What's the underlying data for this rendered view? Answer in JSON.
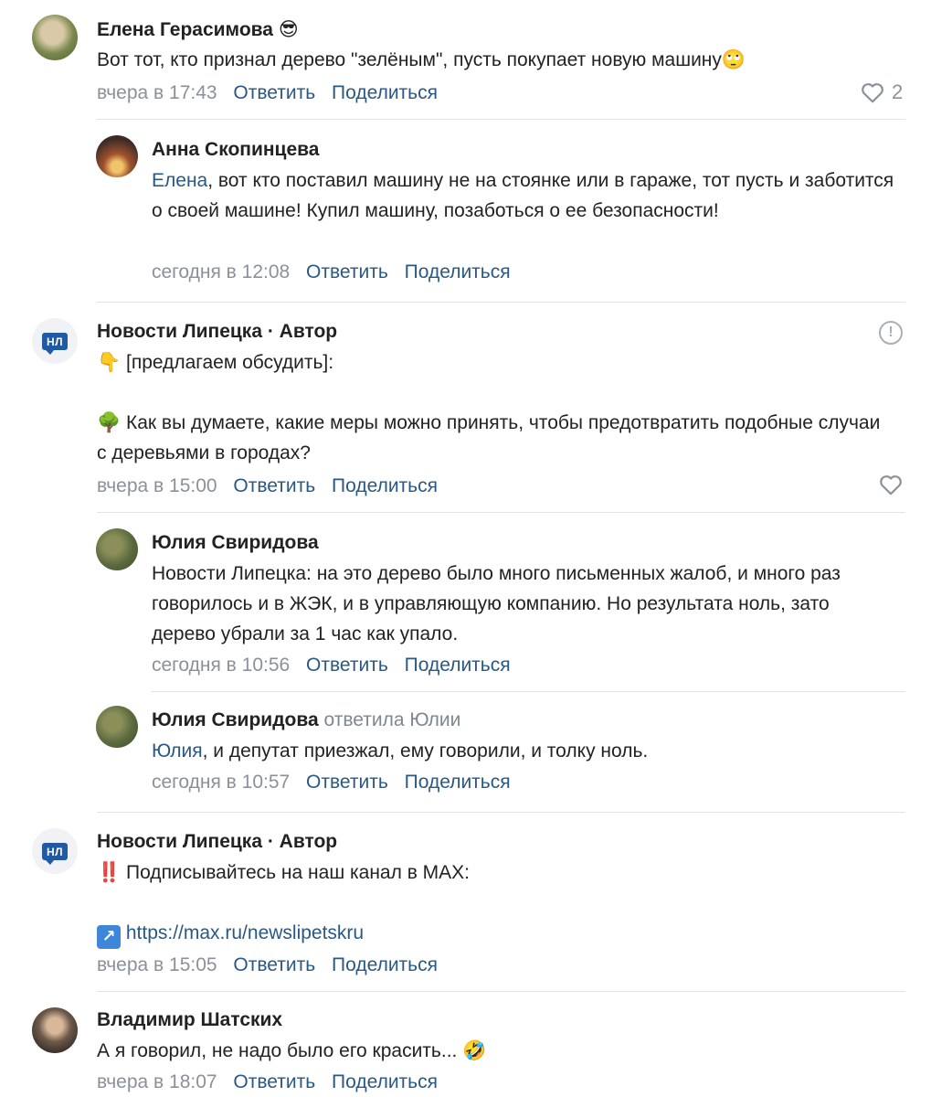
{
  "colors": {
    "link": "#2a5885",
    "meta": "#8a9199",
    "divider": "#dfe3e8",
    "badge": "#1f5aa3"
  },
  "actions": {
    "reply": "Ответить",
    "share": "Поделиться"
  },
  "comments": [
    {
      "author": "Елена Герасимова",
      "author_emoji": "😎",
      "text": "Вот тот, кто признал дерево \"зелёным\", пусть покупает новую машину",
      "text_emoji": "🙄",
      "time": "вчера в 17:43",
      "likes": "2"
    },
    {
      "author": "Анна Скопинцева",
      "mention": "Елена",
      "text": ", вот кто поставил машину не на стоянке или в гараже, тот пусть и заботится о своей машине! Купил машину, позаботься о ее безопасности!",
      "time": "сегодня в 12:08"
    },
    {
      "author": "Новости Липецка",
      "role": " · Автор",
      "avatar_text": "НЛ",
      "line1_emoji": "👇",
      "line1": "[предлагаем обсудить]:",
      "line2_emoji": "🌳",
      "line2": "Как вы думаете, какие меры можно принять, чтобы предотвратить подобные случаи с деревьями в городах?",
      "time": "вчера в 15:00",
      "info_icon": "!"
    },
    {
      "author": "Юлия Свиридова",
      "text": "Новости Липецка: на это дерево было много письменных жалоб, и много раз говорилось и в ЖЭК, и в управляющую компанию. Но результата ноль, зато дерево убрали за 1 час как упало.",
      "time": "сегодня в 10:56"
    },
    {
      "author": "Юлия Свиридова",
      "replied": "ответила Юлии",
      "mention": "Юлия",
      "text": ", и депутат приезжал, ему говорили, и толку ноль.",
      "time": "сегодня в 10:57"
    },
    {
      "author": "Новости Липецка",
      "role": " · Автор",
      "avatar_text": "НЛ",
      "line1_emoji": "‼️",
      "line1": "Подписывайтесь на наш канал в MAX:",
      "link_emoji": "↗",
      "link": "https://max.ru/newslipetskru",
      "time": "вчера в 15:05"
    },
    {
      "author": "Владимир Шатских",
      "text": "А я говорил, не надо было его красить... ",
      "text_emoji": "🤣",
      "time": "вчера в 18:07"
    }
  ]
}
